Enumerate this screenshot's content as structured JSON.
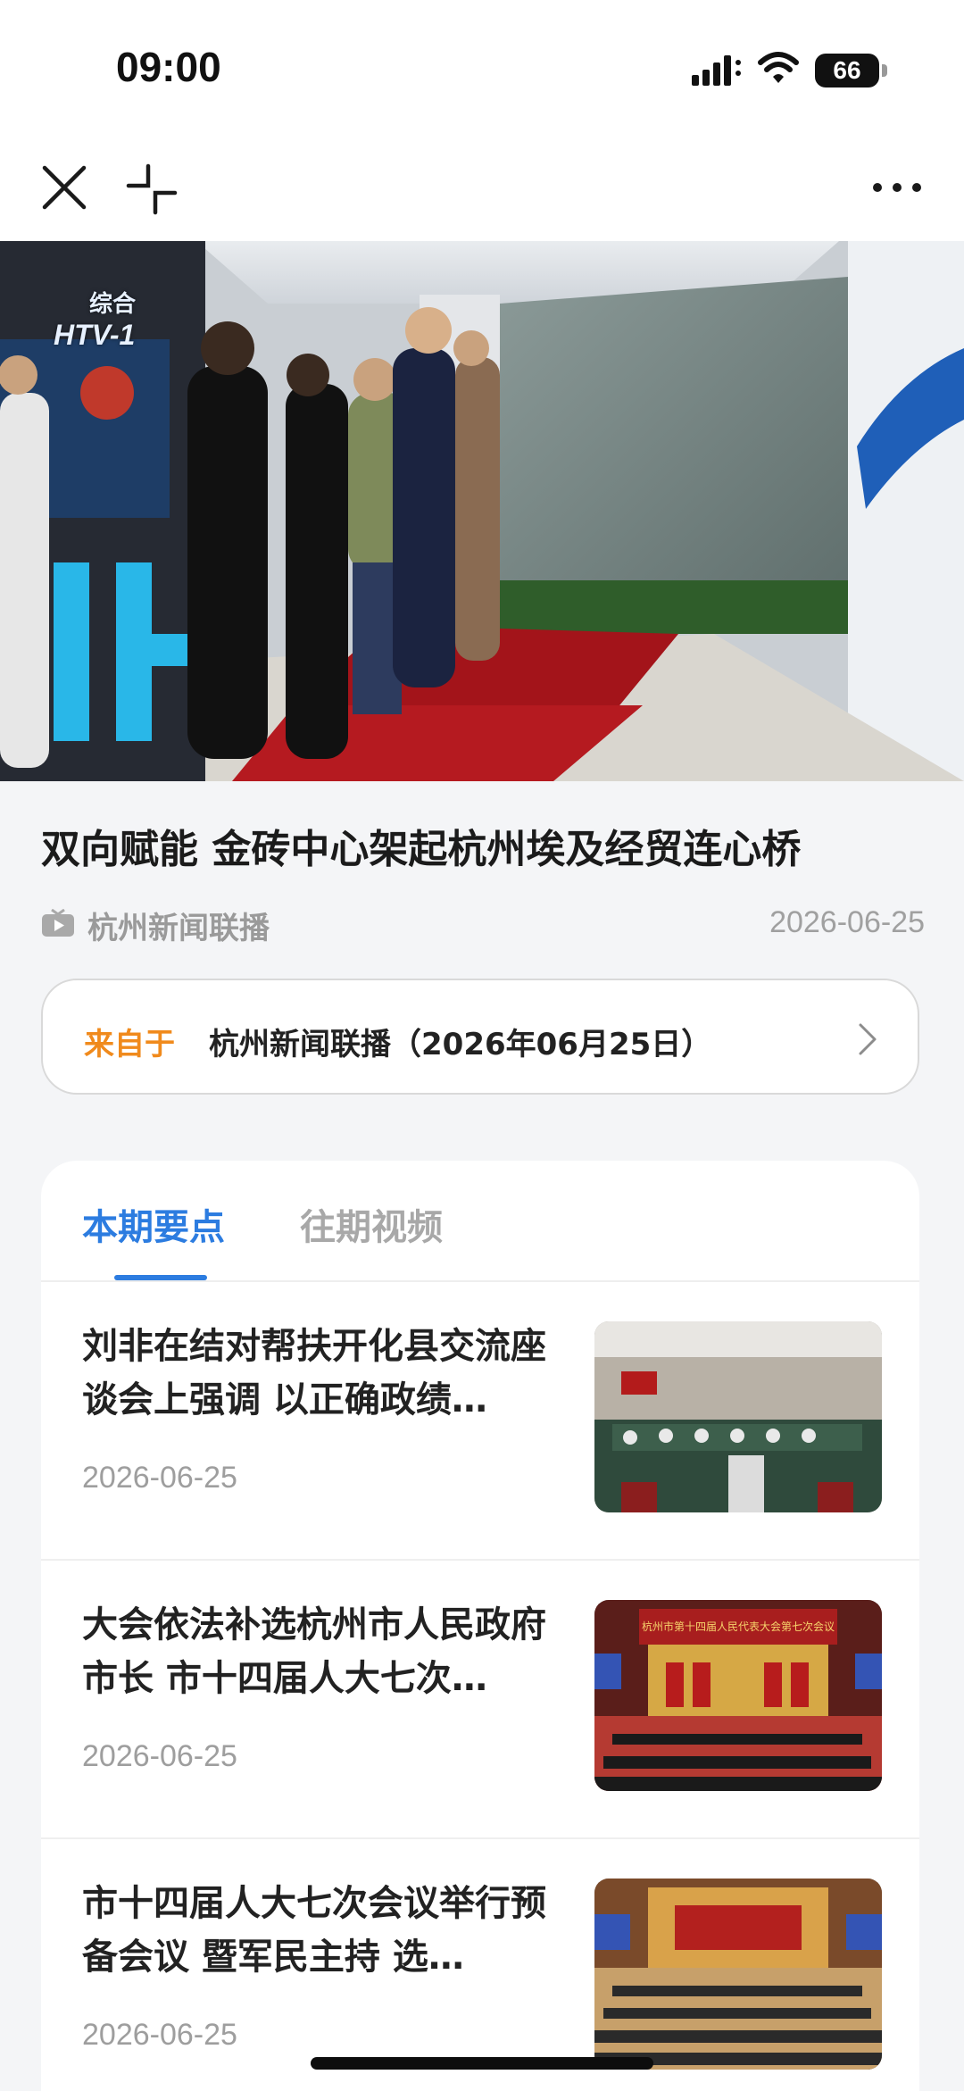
{
  "status_bar": {
    "time": "09:00",
    "battery": "66"
  },
  "nav": {
    "close_icon": "close-icon",
    "minimize_icon": "minimize-icon",
    "more_icon": "more-icon"
  },
  "video": {
    "channel_line1": "综合",
    "channel_line2": "HTV-1"
  },
  "article": {
    "title": "双向赋能 金砖中心架起杭州埃及经贸连心桥",
    "source": "杭州新闻联播",
    "date": "2026-06-25"
  },
  "from_card": {
    "label": "来自于",
    "text": "杭州新闻联播（2026年06月25日）"
  },
  "tabs": [
    {
      "label": "本期要点",
      "active": true
    },
    {
      "label": "往期视频",
      "active": false
    }
  ],
  "news": [
    {
      "title": "刘非在结对帮扶开化县交流座谈会上强调 以正确政绩…",
      "date": "2026-06-25"
    },
    {
      "title": "大会依法补选杭州市人民政府市长 市十四届人大七次…",
      "date": "2026-06-25",
      "banner": "杭州市第十四届人民代表大会第七次会议"
    },
    {
      "title": "市十四届人大七次会议举行预备会议 暨军民主持 选…",
      "date": "2026-06-25"
    }
  ],
  "colors": {
    "accent": "#2c7ce0",
    "orange": "#f08a1c"
  }
}
